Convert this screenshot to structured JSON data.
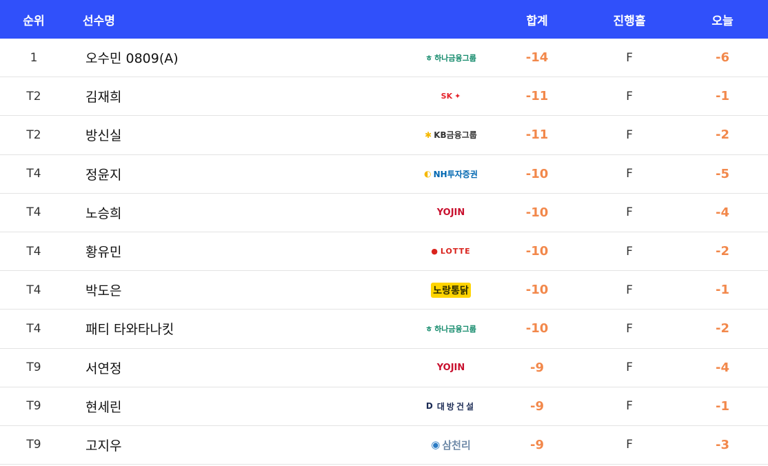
{
  "header": {
    "rank": "순위",
    "player": "선수명",
    "total": "합계",
    "holes": "진행홀",
    "today": "오늘"
  },
  "rows": [
    {
      "rank": "1",
      "name": "오수민 0809(A)",
      "sponsor": "하나금융그룹",
      "sponsor_key": "hana",
      "total": "-14",
      "holes": "F",
      "today": "-6"
    },
    {
      "rank": "T2",
      "name": "김재희",
      "sponsor": "SK",
      "sponsor_key": "sk",
      "total": "-11",
      "holes": "F",
      "today": "-1"
    },
    {
      "rank": "T2",
      "name": "방신실",
      "sponsor": "KB금융그룹",
      "sponsor_key": "kb",
      "total": "-11",
      "holes": "F",
      "today": "-2"
    },
    {
      "rank": "T4",
      "name": "정윤지",
      "sponsor": "NH투자증권",
      "sponsor_key": "nh",
      "total": "-10",
      "holes": "F",
      "today": "-5"
    },
    {
      "rank": "T4",
      "name": "노승희",
      "sponsor": "YOJIN",
      "sponsor_key": "yojin",
      "total": "-10",
      "holes": "F",
      "today": "-4"
    },
    {
      "rank": "T4",
      "name": "황유민",
      "sponsor": "LOTTE",
      "sponsor_key": "lotte",
      "total": "-10",
      "holes": "F",
      "today": "-2"
    },
    {
      "rank": "T4",
      "name": "박도은",
      "sponsor": "노랑통닭",
      "sponsor_key": "nore",
      "total": "-10",
      "holes": "F",
      "today": "-1"
    },
    {
      "rank": "T4",
      "name": "패티 타와타나킷",
      "sponsor": "하나금융그룹",
      "sponsor_key": "hana",
      "total": "-10",
      "holes": "F",
      "today": "-2"
    },
    {
      "rank": "T9",
      "name": "서연정",
      "sponsor": "YOJIN",
      "sponsor_key": "yojin",
      "total": "-9",
      "holes": "F",
      "today": "-4"
    },
    {
      "rank": "T9",
      "name": "현세린",
      "sponsor": "대방건설",
      "sponsor_key": "daebang",
      "total": "-9",
      "holes": "F",
      "today": "-1"
    },
    {
      "rank": "T9",
      "name": "고지우",
      "sponsor": "삼천리",
      "sponsor_key": "samchully",
      "total": "-9",
      "holes": "F",
      "today": "-3"
    }
  ],
  "colors": {
    "header_bg": "#3050fa",
    "score": "#f2884b"
  }
}
